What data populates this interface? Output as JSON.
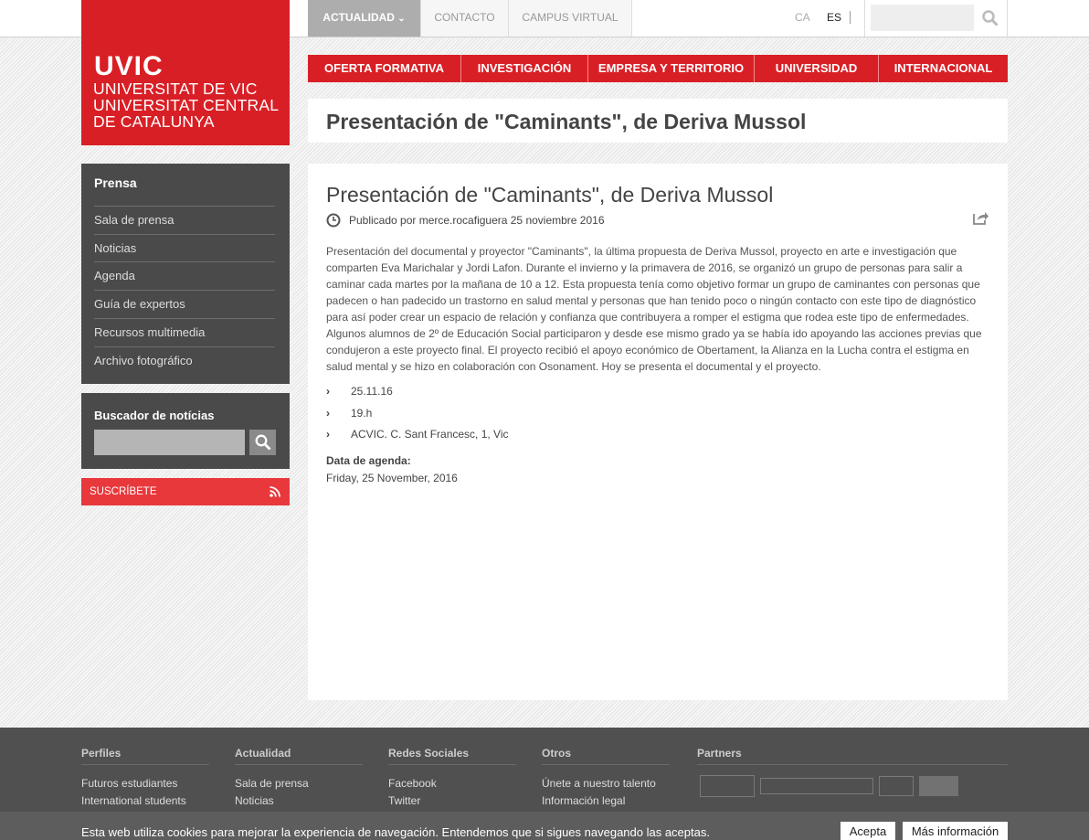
{
  "topbar": {
    "tabs": [
      "ACTUALIDAD",
      "CONTACTO",
      "CAMPUS VIRTUAL"
    ],
    "langs": [
      "CA",
      "ES"
    ],
    "search_placeholder": ""
  },
  "logo": {
    "brand": "UVIC",
    "lines": [
      "UNIVERSITAT DE VIC",
      "UNIVERSITAT CENTRAL",
      "DE CATALUNYA"
    ]
  },
  "main_nav": [
    "OFERTA FORMATIVA",
    "INVESTIGACIÓN",
    "EMPRESA Y TERRITORIO",
    "UNIVERSIDAD",
    "INTERNACIONAL"
  ],
  "page_title": "Presentación de \"Caminants\", de Deriva Mussol",
  "sidebar": {
    "heading": "Prensa",
    "items": [
      "Sala de prensa",
      "Noticias",
      "Agenda",
      "Guía de expertos",
      "Recursos multimedia",
      "Archivo fotográfico"
    ]
  },
  "news_search": {
    "title": "Buscador de notícias",
    "placeholder": ""
  },
  "subscribe": {
    "label": "SUSCRÍBETE"
  },
  "article": {
    "title": "Presentación de \"Caminants\", de Deriva Mussol",
    "meta": "Publicado por merce.rocafiguera 25 noviembre 2016",
    "body": "Presentación del documental y proyector \"Caminants\", la última propuesta de Deriva Mussol, proyecto en arte e investigación que comparten Eva Marichalar y Jordi Lafon. Durante el invierno y la primavera de 2016, se organizó un grupo de personas para salir a caminar cada martes por la mañana de 10 a 12. Esta propuesta tenía como objetivo formar un grupo de caminantes con personas que padecen o han padecido un trastorno en salud mental y personas que han tenido poco o ningún contacto con este tipo de diagnóstico para así poder crear un espacio de relación y confianza que contribuyera a romper el estigma que rodea este tipo de enfermedades. Algunos alumnos de 2º de Educación Social participaron y desde ese mismo grado ya se había ido apoyando las acciones previas que condujeron a este proyecto final. El proyecto recibió el apoyo económico de Obertament, la Alianza en la Lucha contra el estigma en salud mental y se hizo en colaboración con Osonament. Hoy se presenta el documental y el proyecto.",
    "bullets": [
      "25.11.16",
      "19.h",
      "ACVIC. C. Sant Francesc, 1, Vic"
    ],
    "agenda_label": "Data de agenda:",
    "agenda_date": "Friday, 25 November, 2016"
  },
  "footer": {
    "columns": [
      {
        "heading": "Perfiles",
        "links": [
          "Futuros estudiantes",
          "International students"
        ]
      },
      {
        "heading": "Actualidad",
        "links": [
          "Sala de prensa",
          "Noticias"
        ]
      },
      {
        "heading": "Redes Sociales",
        "links": [
          "Facebook",
          "Twitter"
        ]
      },
      {
        "heading": "Otros",
        "links": [
          "Únete a nuestro talento",
          "Información legal"
        ]
      }
    ],
    "partners_heading": "Partners"
  },
  "cookie": {
    "text": "Esta web utiliza cookies para mejorar la experiencia de navegación. Entendemos que si sigues navegando las aceptas.",
    "accept": "Acepta",
    "more": "Más información"
  },
  "colors": {
    "brand_red": "#d91f26",
    "sidebar_gray": "#4a4a4a",
    "footer_gray": "#505050"
  }
}
